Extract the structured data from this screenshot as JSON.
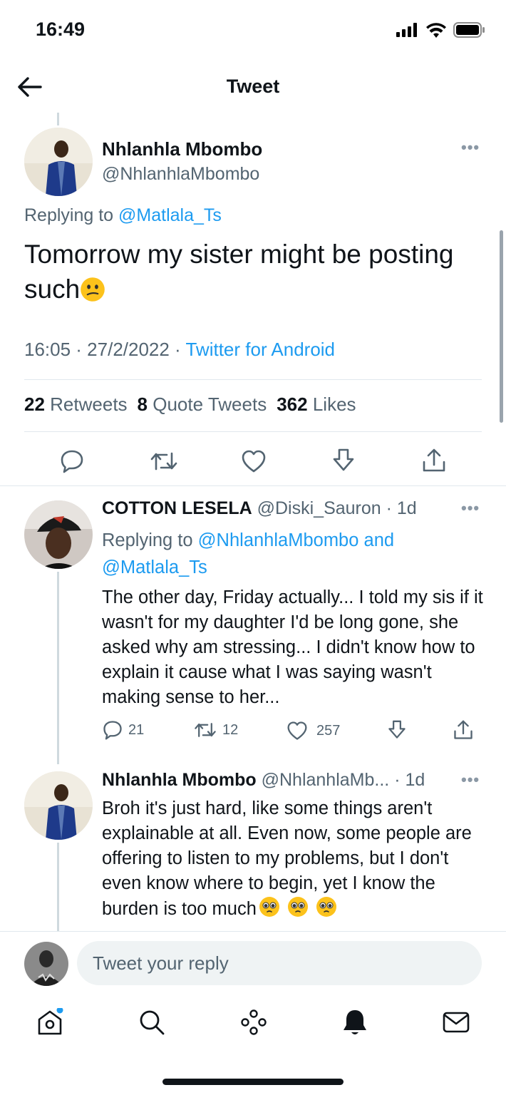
{
  "status": {
    "time": "16:49"
  },
  "nav": {
    "title": "Tweet"
  },
  "main_tweet": {
    "name": "Nhlanhla Mbombo",
    "handle": "@NhlanhlaMbombo",
    "replying_prefix": "Replying to",
    "replying_to": "@Matlala_Ts",
    "text": "Tomorrow my sister might be posting such",
    "emoji": "confused-face",
    "time_date": "16:05 · 27/2/2022 · ",
    "source": "Twitter for Android",
    "retweets": "22",
    "retweets_label": "Retweets",
    "quotes": "8",
    "quotes_label": "Quote Tweets",
    "likes": "362",
    "likes_label": "Likes"
  },
  "replies": [
    {
      "name": "COTTON LESELA",
      "handle": "@Diski_Sauron",
      "age": " · 1d",
      "replying_prefix": "Replying to",
      "replying_to_1": "@NhlanhlaMbombo",
      "replying_and": "and",
      "replying_to_2": "@Matlala_Ts",
      "text": "The other day, Friday actually... I told my sis if it wasn't for my daughter I'd be long gone, she asked why am stressing... I didn't know how to explain it cause what I was saying wasn't making sense to her...",
      "reply_count": "21",
      "retweet_count": "12",
      "like_count": "257"
    },
    {
      "name": "Nhlanhla Mbombo",
      "handle": "@NhlanhlaMb...",
      "age": " · 1d",
      "text": "Broh it's just hard, like some things aren't explainable at all. Even now, some people are offering to listen to my problems, but I don't even know where to begin, yet I know the burden is too much",
      "emoji": "pleading-face"
    }
  ],
  "compose": {
    "placeholder": "Tweet your reply"
  },
  "colors": {
    "accent": "#1d9bf0",
    "text": "#0f1419",
    "muted": "#536471",
    "divider": "#e1e8ed"
  }
}
